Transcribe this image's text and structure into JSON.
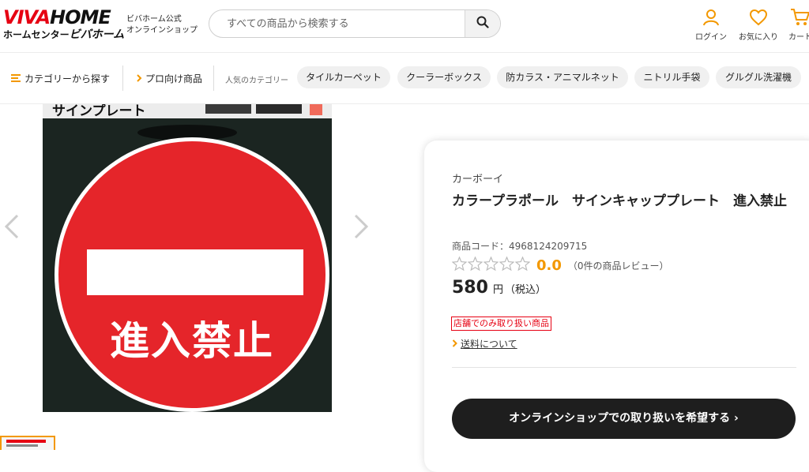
{
  "header": {
    "logo_main_a": "VIVA",
    "logo_main_b": "HOME",
    "logo_sub_small": "ホームセンター",
    "logo_sub_big": "ビバホーム",
    "official_line1": "ビバホーム公式",
    "official_line2": "オンラインショップ",
    "search_placeholder": "すべての商品から検索する",
    "icons": [
      {
        "name": "user-icon",
        "label": "ログイン"
      },
      {
        "name": "heart-icon",
        "label": "お気に入り"
      },
      {
        "name": "cart-icon",
        "label": "カート"
      }
    ],
    "accent_color": "#f39800",
    "brand_red": "#e60012"
  },
  "nav": {
    "category_label": "カテゴリーから探す",
    "pro_label": "プロ向け商品",
    "popular_label": "人気のカテゴリー",
    "chips": [
      "タイルカーペット",
      "クーラーボックス",
      "防カラス・アニマルネット",
      "ニトリル手袋",
      "グルグル洗濯機"
    ]
  },
  "product": {
    "image_caption_top": "サインプレート",
    "sign_text": "進入禁止",
    "brand": "カーボーイ",
    "title": "カラープラポール　サインキャッププレート　進入禁止",
    "code_label": "商品コード：",
    "code": "4968124209715",
    "rating_score": "0.0",
    "review_text": "（0件の商品レビュー）",
    "stars_filled": 0,
    "price": "580",
    "price_unit": "円",
    "tax_label": "（税込）",
    "badge": "店舗でのみ取り扱い商品",
    "shipping_link": "送料について",
    "cta": "オンラインショップでの取り扱いを希望する ›"
  }
}
